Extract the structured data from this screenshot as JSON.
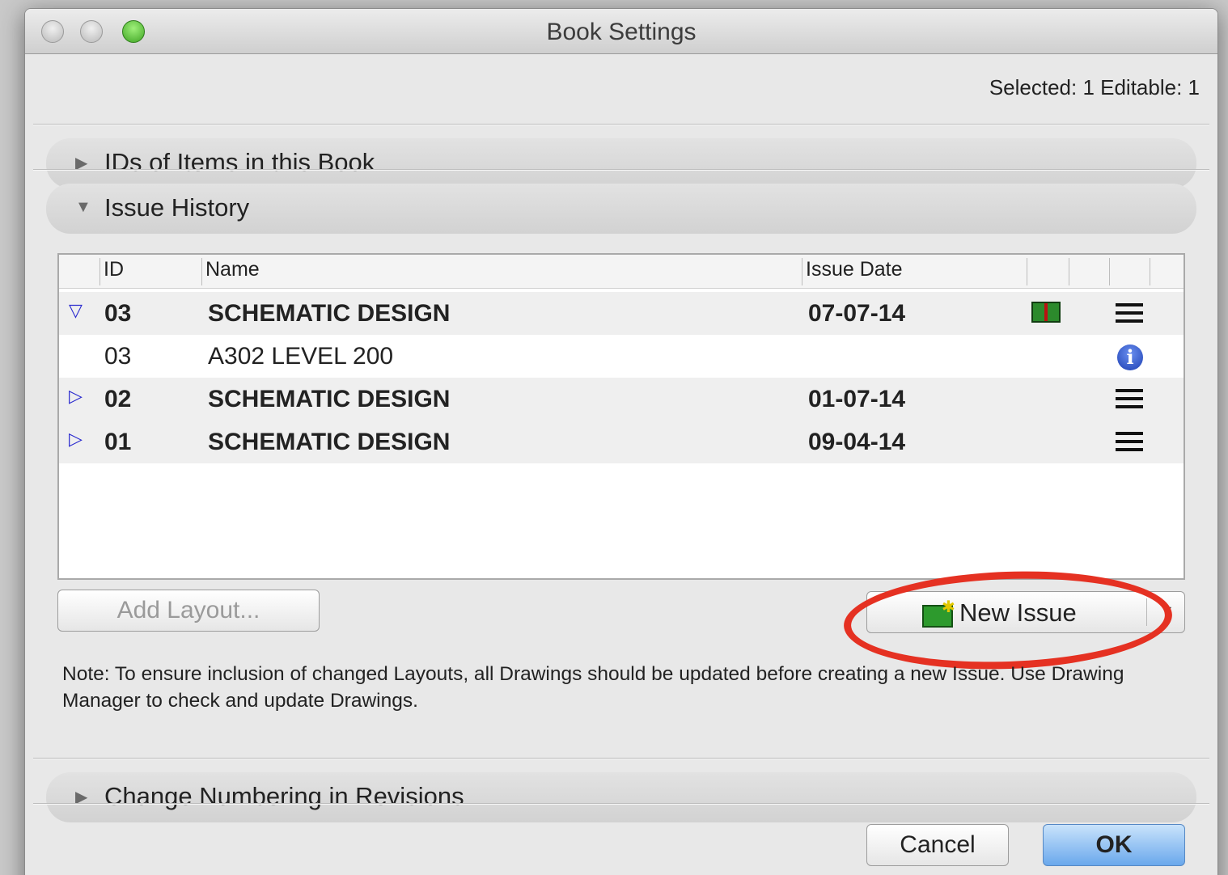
{
  "window": {
    "title": "Book Settings"
  },
  "selection_info": "Selected: 1 Editable: 1",
  "sections": {
    "ids_of_items": "IDs of Items in this Book",
    "issue_history": "Issue History",
    "change_numbering": "Change Numbering in Revisions"
  },
  "table": {
    "columns": {
      "id": "ID",
      "name": "Name",
      "issue_date": "Issue Date"
    },
    "rows": [
      {
        "id": "03",
        "name": "SCHEMATIC DESIGN",
        "date": "07-07-14",
        "expanded": true
      },
      {
        "id": "03",
        "name": "A302 LEVEL 200",
        "date": ""
      },
      {
        "id": "02",
        "name": "SCHEMATIC DESIGN",
        "date": "01-07-14",
        "expanded": false
      },
      {
        "id": "01",
        "name": "SCHEMATIC DESIGN",
        "date": "09-04-14",
        "expanded": false
      }
    ]
  },
  "buttons": {
    "add_layout": "Add Layout...",
    "new_issue": "New Issue",
    "cancel": "Cancel",
    "ok": "OK"
  },
  "note": "Note: To ensure inclusion of changed Layouts, all Drawings should be updated before creating a new Issue. Use Drawing Manager to check and update Drawings.",
  "colors": {
    "annotation": "#e53122",
    "ok_button": "#6aa8ec"
  }
}
